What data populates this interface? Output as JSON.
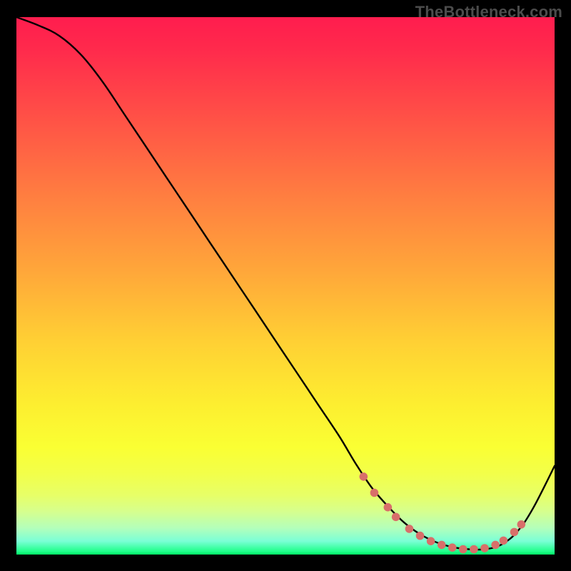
{
  "attribution": "TheBottleneck.com",
  "chart_data": {
    "type": "line",
    "title": "",
    "xlabel": "",
    "ylabel": "",
    "xlim": [
      0,
      100
    ],
    "ylim": [
      0,
      100
    ],
    "series": [
      {
        "name": "bottleneck-curve",
        "x": [
          0,
          4,
          8,
          12,
          16,
          20,
          24,
          28,
          32,
          36,
          40,
          44,
          48,
          52,
          56,
          60,
          63,
          66,
          69,
          72,
          75,
          78,
          81,
          84,
          87,
          90,
          93,
          96,
          100
        ],
        "y": [
          100,
          98.5,
          96.5,
          93,
          88,
          82,
          76,
          70,
          64,
          58,
          52,
          46,
          40,
          34,
          28,
          22,
          17,
          12.5,
          9,
          6,
          3.8,
          2.3,
          1.4,
          1.0,
          1.0,
          1.8,
          4.2,
          8.6,
          16.5
        ]
      }
    ],
    "markers": {
      "name": "highlight-dots",
      "color": "#d86f6a",
      "points": [
        {
          "x": 64.5,
          "y": 14.5
        },
        {
          "x": 66.5,
          "y": 11.5
        },
        {
          "x": 69.0,
          "y": 8.8
        },
        {
          "x": 70.5,
          "y": 7.0
        },
        {
          "x": 73.0,
          "y": 4.8
        },
        {
          "x": 75.0,
          "y": 3.5
        },
        {
          "x": 77.0,
          "y": 2.5
        },
        {
          "x": 79.0,
          "y": 1.8
        },
        {
          "x": 81.0,
          "y": 1.3
        },
        {
          "x": 83.0,
          "y": 1.0
        },
        {
          "x": 85.0,
          "y": 1.0
        },
        {
          "x": 87.0,
          "y": 1.2
        },
        {
          "x": 89.0,
          "y": 1.8
        },
        {
          "x": 90.5,
          "y": 2.6
        },
        {
          "x": 92.5,
          "y": 4.2
        },
        {
          "x": 93.8,
          "y": 5.6
        }
      ]
    },
    "gradient_stops": [
      {
        "pos": 0.0,
        "color": "#ff1d4e"
      },
      {
        "pos": 0.5,
        "color": "#ffcf34"
      },
      {
        "pos": 0.9,
        "color": "#e7ff68"
      },
      {
        "pos": 1.0,
        "color": "#00e060"
      }
    ]
  }
}
